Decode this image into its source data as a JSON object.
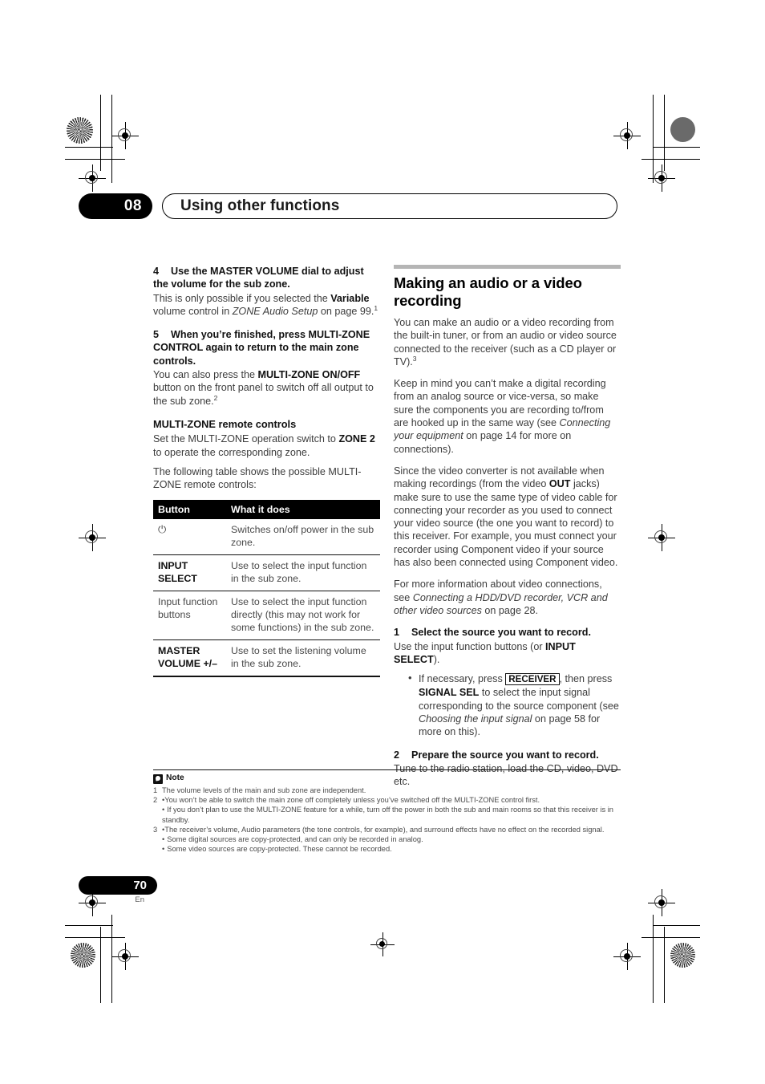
{
  "chapter": {
    "number": "08",
    "title": "Using other functions"
  },
  "left_column": {
    "step4": {
      "number": "4",
      "heading": "Use the MASTER VOLUME dial to adjust the volume for the sub zone.",
      "body_1": "This is only possible if you selected the ",
      "bold_1": "Variable",
      "body_2": " volume control in ",
      "italic_1": "ZONE Audio Setup",
      "body_3": " on page 99.",
      "footnote_ref": "1"
    },
    "step5": {
      "number": "5",
      "heading": "When you’re finished, press MULTI-ZONE CONTROL again to return to the main zone controls.",
      "body_1": "You can also press the ",
      "bold_1": "MULTI-ZONE ON/OFF",
      "body_2": " button on the front panel to switch off all output to the sub zone.",
      "footnote_ref": "2"
    },
    "remote_section": {
      "subhead": "MULTI-ZONE remote controls",
      "para_1a": "Set the MULTI-ZONE operation switch to ",
      "para_1b": "ZONE 2",
      "para_1c": " to operate the corresponding zone.",
      "para_2": "The following table shows the possible MULTI-ZONE remote controls:"
    },
    "table": {
      "headers": [
        "Button",
        "What it does"
      ],
      "rows": [
        {
          "button": "⏻",
          "button_is_icon": true,
          "button_icon_name": "power-icon",
          "description": "Switches on/off power in the sub zone."
        },
        {
          "button": "INPUT SELECT",
          "bold": true,
          "description": "Use to select the input function in the sub zone."
        },
        {
          "button": "Input function buttons",
          "bold": false,
          "description": "Use to select the input function directly (this may not work for some functions) in the sub zone."
        },
        {
          "button": "MASTER VOLUME +/–",
          "bold": true,
          "description": "Use to set the listening volume in the sub zone."
        }
      ]
    }
  },
  "right_column": {
    "section_title": "Making an audio or a video recording",
    "para_1a": "You can make an audio or a video recording from the built-in tuner, or from an audio or video source connected to the receiver (such as a CD player or TV).",
    "para_1_ref": "3",
    "para_2a": "Keep in mind you can’t make a digital recording from an analog source or vice-versa, so make sure the components you are recording to/from are hooked up in the same way (see ",
    "para_2_italic": "Connecting your equipment",
    "para_2b": " on page 14 for more on connections).",
    "para_3a": "Since the video converter is not available when making recordings (from the video ",
    "para_3_bold": "OUT",
    "para_3b": " jacks) make sure to use the same type of video cable for connecting your recorder as you used to connect your video source (the one you want to record) to this receiver. For example, you must connect your recorder using Component video if your source has also been connected using Component video.",
    "para_4a": "For more information about video connections, see ",
    "para_4_italic": "Connecting a HDD/DVD recorder, VCR and other video sources",
    "para_4b": " on page 28.",
    "step1": {
      "number": "1",
      "heading": "Select the source you want to record.",
      "body_1": "Use the input function buttons (or ",
      "bold_1": "INPUT SELECT",
      "body_2": ").",
      "bullet_1a": "If necessary, press ",
      "bullet_1_key": "RECEIVER",
      "bullet_1b": ", then press ",
      "bullet_1_bold": "SIGNAL SEL",
      "bullet_1c": " to select the input signal corresponding to the source component (see ",
      "bullet_1_italic": "Choosing the input signal",
      "bullet_1d": " on page 58 for more on this)."
    },
    "step2": {
      "number": "2",
      "heading": "Prepare the source you want to record.",
      "body": "Tune to the radio station, load the CD, video, DVD etc."
    }
  },
  "notes": {
    "title": "Note",
    "items": [
      {
        "num": "1",
        "lines": [
          {
            "bullet": false,
            "text": "The volume levels of the main and sub zone are independent."
          }
        ]
      },
      {
        "num": "2",
        "lines": [
          {
            "bullet": true,
            "text": "You won’t be able to switch the main zone off completely unless you’ve switched off the MULTI-ZONE control first."
          },
          {
            "bullet": true,
            "text": "If you don’t plan to use the MULTI-ZONE feature for a while, turn off the power in both the sub and main rooms so that this receiver is in standby."
          }
        ]
      },
      {
        "num": "3",
        "lines": [
          {
            "bullet": true,
            "text": "The receiver’s volume, Audio parameters (the tone controls, for example), and surround effects have no effect on the recorded signal."
          },
          {
            "bullet": true,
            "text": "Some digital sources are copy-protected, and can only be recorded in analog."
          },
          {
            "bullet": true,
            "text": "Some video sources are copy-protected. These cannot be recorded."
          }
        ]
      }
    ]
  },
  "footer": {
    "page_number": "70",
    "language": "En"
  },
  "colors": {
    "ink": "#1a1a1a",
    "body_text": "#3c3c3c",
    "rule_gray": "#b5b5b5",
    "black_bar": "#000000"
  }
}
